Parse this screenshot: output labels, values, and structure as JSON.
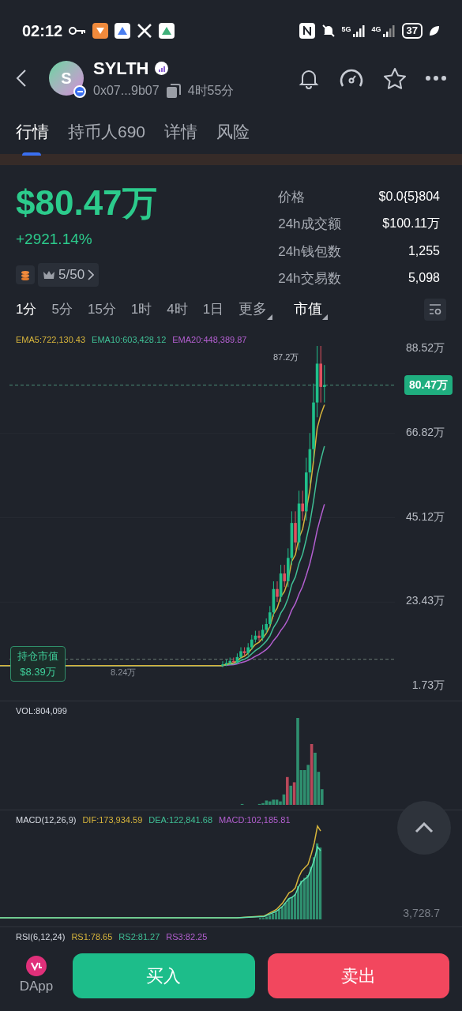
{
  "status_bar": {
    "time": "02:12",
    "network_1": "5G",
    "network_2": "4G",
    "battery": "37"
  },
  "header": {
    "avatar_letter": "S",
    "symbol": "SYLTH",
    "address": "0x07...9b07",
    "age": "4时55分"
  },
  "tabs": [
    {
      "label": "行情",
      "selected": true
    },
    {
      "label": "持币人690",
      "selected": false
    },
    {
      "label": "详情",
      "selected": false
    },
    {
      "label": "风险",
      "selected": false
    }
  ],
  "summary": {
    "market_cap": "$80.47万",
    "change": "+2921.14%",
    "rank": "5/50"
  },
  "stats": [
    {
      "label": "价格",
      "value": "$0.0{5}804"
    },
    {
      "label": "24h成交额",
      "value": "$100.11万"
    },
    {
      "label": "24h钱包数",
      "value": "1,255"
    },
    {
      "label": "24h交易数",
      "value": "5,098"
    }
  ],
  "intervals": [
    {
      "label": "1分",
      "kind": "interval",
      "selected": true
    },
    {
      "label": "5分",
      "kind": "interval",
      "selected": false
    },
    {
      "label": "15分",
      "kind": "interval",
      "selected": false
    },
    {
      "label": "1时",
      "kind": "interval",
      "selected": false
    },
    {
      "label": "4时",
      "kind": "interval",
      "selected": false
    },
    {
      "label": "1日",
      "kind": "interval",
      "selected": false
    },
    {
      "label": "更多",
      "kind": "dropdown",
      "selected": false
    },
    {
      "label": "市值",
      "kind": "dropdown",
      "selected": true
    }
  ],
  "ema_legend": [
    {
      "label": "EMA5:722,130.43",
      "color": "#d6b43c"
    },
    {
      "label": "EMA10:603,428.12",
      "color": "#3fbf95"
    },
    {
      "label": "EMA20:448,389.87",
      "color": "#b35fd0"
    }
  ],
  "price_chart": {
    "axis_labels": [
      "88.52万",
      "66.82万",
      "45.12万",
      "23.43万",
      "1.73万"
    ],
    "current_tag": "80.47万",
    "high_label": "87.2万",
    "low_label": "8.24万",
    "hold_label": "持仓市值",
    "hold_value": "$8.39万"
  },
  "volume": {
    "label": "VOL:804,099"
  },
  "macd": {
    "label": "MACD(12,26,9)",
    "legend": [
      {
        "label": "DIF:173,934.59",
        "color": "#d6b43c"
      },
      {
        "label": "DEA:122,841.68",
        "color": "#3fbf95"
      },
      {
        "label": "MACD:102,185.81",
        "color": "#b35fd0"
      }
    ],
    "axis_label": "3,728.7"
  },
  "rsi": {
    "label": "RSI(6,12,24)",
    "legend": [
      {
        "label": "RS1:78.65",
        "color": "#d6b43c"
      },
      {
        "label": "RS2:81.27",
        "color": "#3fbf95"
      },
      {
        "label": "RS3:82.25",
        "color": "#b35fd0"
      }
    ]
  },
  "bottom_bar": {
    "dapp": "DApp",
    "buy": "买入",
    "sell": "卖出"
  }
}
